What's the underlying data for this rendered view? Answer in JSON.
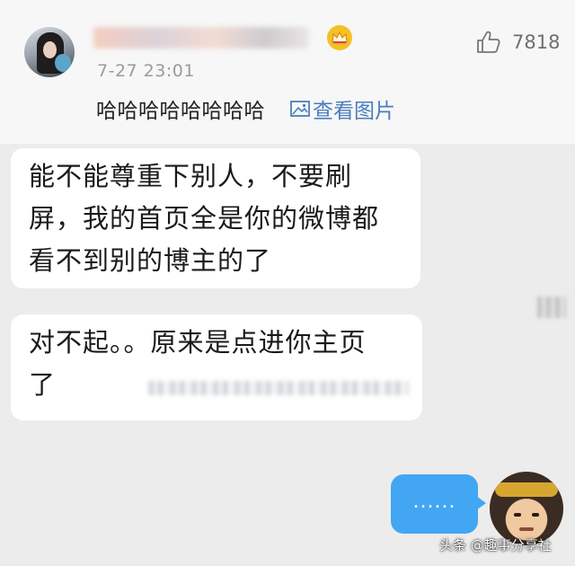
{
  "comment": {
    "timestamp": "7-27 23:01",
    "like_count": "7818",
    "text": "哈哈哈哈哈哈哈哈",
    "view_image_label": "查看图片"
  },
  "chat": {
    "messages": [
      {
        "text": "能不能尊重下别人，不要刷\n屏，我的首页全是你的微博都\n看不到别的博主的了"
      },
      {
        "text": "对不起。。原来是点进你主页\n了"
      }
    ],
    "typing_indicator": "......"
  },
  "watermark": "头条 @趣事分享社",
  "colors": {
    "link": "#4a7dbd",
    "bubble_self": "#43a6f2",
    "bubble_other": "#ffffff",
    "crown_badge": "#f5c024"
  },
  "icons": [
    "crown-icon",
    "thumbs-up-icon",
    "image-icon"
  ]
}
